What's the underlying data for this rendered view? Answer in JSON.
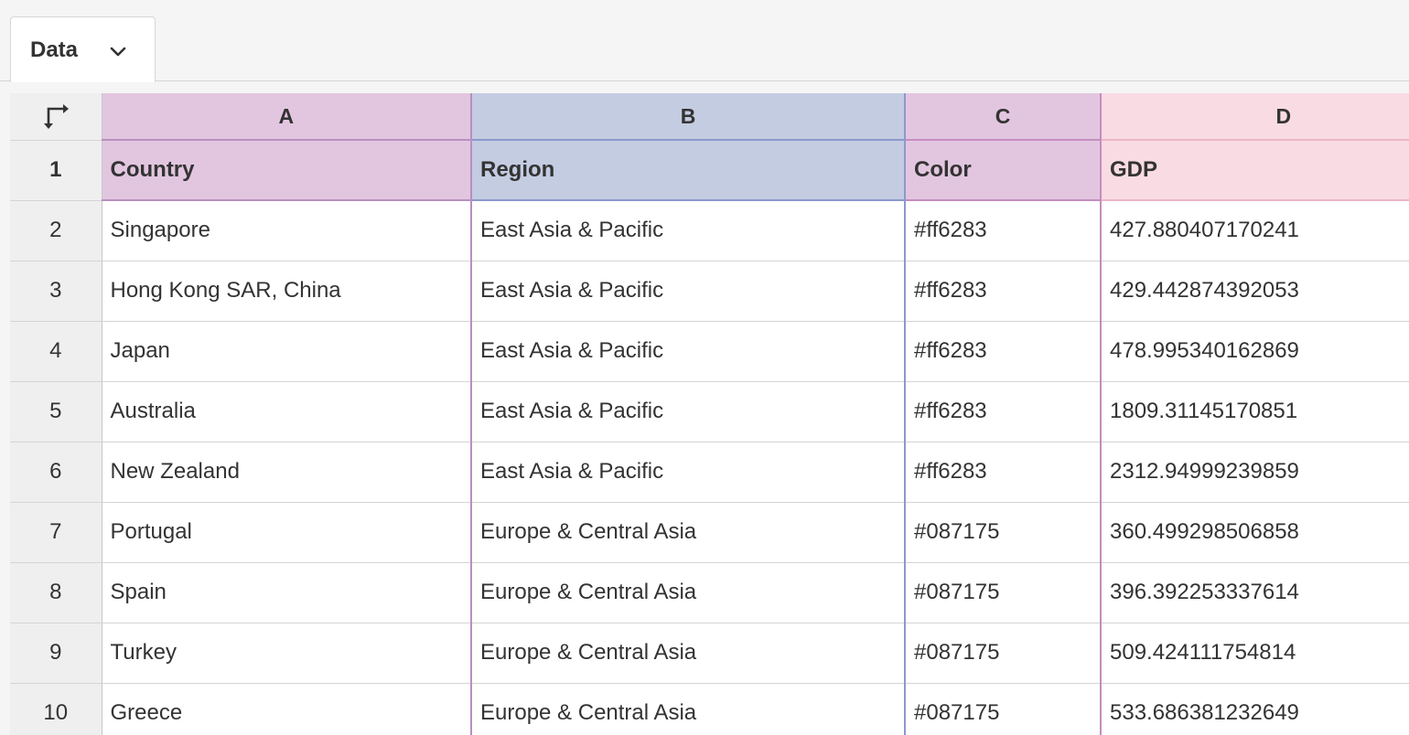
{
  "tab": {
    "label": "Data",
    "icon": "chevron-down-icon"
  },
  "corner": {
    "icon": "transpose-icon"
  },
  "columns": [
    "A",
    "B",
    "C",
    "D"
  ],
  "row_numbers": [
    "1",
    "2",
    "3",
    "4",
    "5",
    "6",
    "7",
    "8",
    "9",
    "10"
  ],
  "header_row": [
    "Country",
    "Region",
    "Color",
    "GDP"
  ],
  "rows": [
    [
      "Singapore",
      "East Asia & Pacific",
      "#ff6283",
      "427.880407170241"
    ],
    [
      "Hong Kong SAR, China",
      "East Asia & Pacific",
      "#ff6283",
      "429.442874392053"
    ],
    [
      "Japan",
      "East Asia & Pacific",
      "#ff6283",
      "478.995340162869"
    ],
    [
      "Australia",
      "East Asia & Pacific",
      "#ff6283",
      "1809.31145170851"
    ],
    [
      "New Zealand",
      "East Asia & Pacific",
      "#ff6283",
      "2312.94999239859"
    ],
    [
      "Portugal",
      "Europe & Central Asia",
      "#087175",
      "360.499298506858"
    ],
    [
      "Spain",
      "Europe & Central Asia",
      "#087175",
      "396.392253337614"
    ],
    [
      "Turkey",
      "Europe & Central Asia",
      "#087175",
      "509.424111754814"
    ],
    [
      "Greece",
      "Europe & Central Asia",
      "#087175",
      "533.686381232649"
    ]
  ],
  "colors": {
    "col_a_bg": "#e2c6e0",
    "col_b_bg": "#c4cce2",
    "col_c_bg": "#e2c6e0",
    "col_d_bg": "#f9dbe3"
  }
}
